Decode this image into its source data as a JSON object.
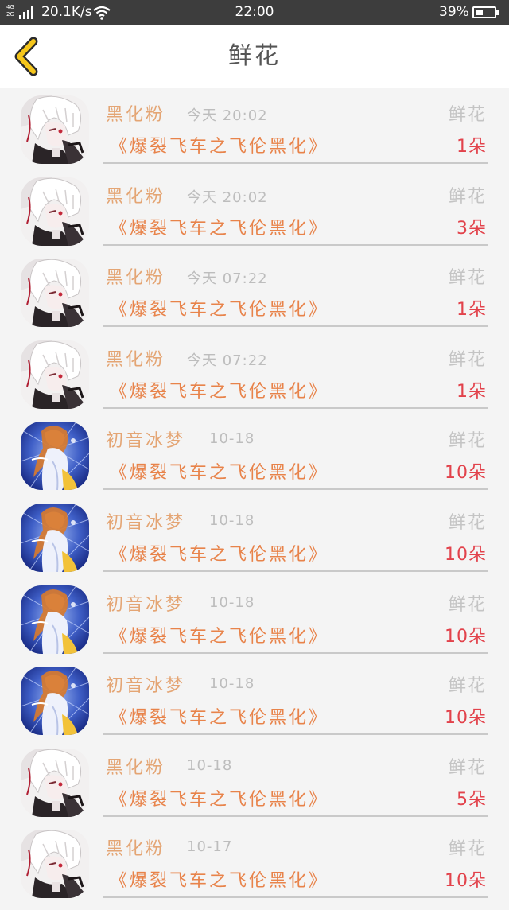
{
  "status_bar": {
    "network": "4G\n2G",
    "speed": "20.1K/s",
    "time": "22:00",
    "battery": "39%",
    "battery_level": 0.39
  },
  "header": {
    "title": "鲜花"
  },
  "records": [
    {
      "avatar": "tokyo-ghoul",
      "name": "黑化粉",
      "time": "今天 20:02",
      "gift": "鲜花",
      "book": "《爆裂飞车之飞伦黑化》",
      "count": "1朵"
    },
    {
      "avatar": "tokyo-ghoul",
      "name": "黑化粉",
      "time": "今天 20:02",
      "gift": "鲜花",
      "book": "《爆裂飞车之飞伦黑化》",
      "count": "3朵"
    },
    {
      "avatar": "tokyo-ghoul",
      "name": "黑化粉",
      "time": "今天 07:22",
      "gift": "鲜花",
      "book": "《爆裂飞车之飞伦黑化》",
      "count": "1朵"
    },
    {
      "avatar": "tokyo-ghoul",
      "name": "黑化粉",
      "time": "今天 07:22",
      "gift": "鲜花",
      "book": "《爆裂飞车之飞伦黑化》",
      "count": "1朵"
    },
    {
      "avatar": "hatsune-ice",
      "name": "初音冰梦",
      "time": "10-18",
      "gift": "鲜花",
      "book": "《爆裂飞车之飞伦黑化》",
      "count": "10朵"
    },
    {
      "avatar": "hatsune-ice",
      "name": "初音冰梦",
      "time": "10-18",
      "gift": "鲜花",
      "book": "《爆裂飞车之飞伦黑化》",
      "count": "10朵"
    },
    {
      "avatar": "hatsune-ice",
      "name": "初音冰梦",
      "time": "10-18",
      "gift": "鲜花",
      "book": "《爆裂飞车之飞伦黑化》",
      "count": "10朵"
    },
    {
      "avatar": "hatsune-ice",
      "name": "初音冰梦",
      "time": "10-18",
      "gift": "鲜花",
      "book": "《爆裂飞车之飞伦黑化》",
      "count": "10朵"
    },
    {
      "avatar": "tokyo-ghoul",
      "name": "黑化粉",
      "time": "10-18",
      "gift": "鲜花",
      "book": "《爆裂飞车之飞伦黑化》",
      "count": "5朵"
    },
    {
      "avatar": "tokyo-ghoul",
      "name": "黑化粉",
      "time": "10-17",
      "gift": "鲜花",
      "book": "《爆裂飞车之飞伦黑化》",
      "count": "10朵"
    }
  ]
}
